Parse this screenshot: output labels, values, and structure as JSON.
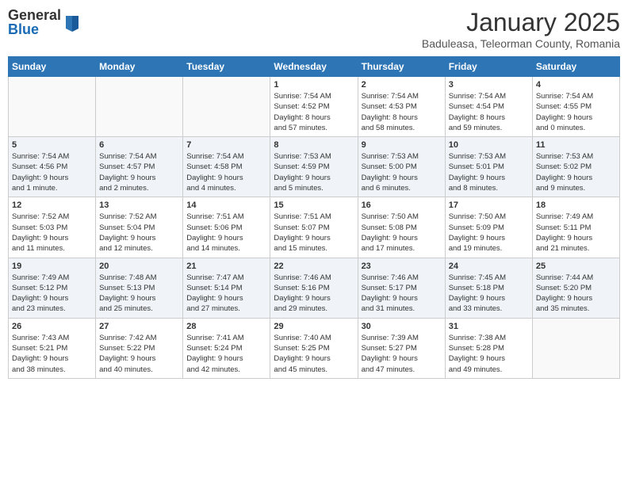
{
  "logo": {
    "general": "General",
    "blue": "Blue"
  },
  "title": "January 2025",
  "location": "Baduleasa, Teleorman County, Romania",
  "weekdays": [
    "Sunday",
    "Monday",
    "Tuesday",
    "Wednesday",
    "Thursday",
    "Friday",
    "Saturday"
  ],
  "weeks": [
    [
      {
        "day": "",
        "info": ""
      },
      {
        "day": "",
        "info": ""
      },
      {
        "day": "",
        "info": ""
      },
      {
        "day": "1",
        "info": "Sunrise: 7:54 AM\nSunset: 4:52 PM\nDaylight: 8 hours\nand 57 minutes."
      },
      {
        "day": "2",
        "info": "Sunrise: 7:54 AM\nSunset: 4:53 PM\nDaylight: 8 hours\nand 58 minutes."
      },
      {
        "day": "3",
        "info": "Sunrise: 7:54 AM\nSunset: 4:54 PM\nDaylight: 8 hours\nand 59 minutes."
      },
      {
        "day": "4",
        "info": "Sunrise: 7:54 AM\nSunset: 4:55 PM\nDaylight: 9 hours\nand 0 minutes."
      }
    ],
    [
      {
        "day": "5",
        "info": "Sunrise: 7:54 AM\nSunset: 4:56 PM\nDaylight: 9 hours\nand 1 minute."
      },
      {
        "day": "6",
        "info": "Sunrise: 7:54 AM\nSunset: 4:57 PM\nDaylight: 9 hours\nand 2 minutes."
      },
      {
        "day": "7",
        "info": "Sunrise: 7:54 AM\nSunset: 4:58 PM\nDaylight: 9 hours\nand 4 minutes."
      },
      {
        "day": "8",
        "info": "Sunrise: 7:53 AM\nSunset: 4:59 PM\nDaylight: 9 hours\nand 5 minutes."
      },
      {
        "day": "9",
        "info": "Sunrise: 7:53 AM\nSunset: 5:00 PM\nDaylight: 9 hours\nand 6 minutes."
      },
      {
        "day": "10",
        "info": "Sunrise: 7:53 AM\nSunset: 5:01 PM\nDaylight: 9 hours\nand 8 minutes."
      },
      {
        "day": "11",
        "info": "Sunrise: 7:53 AM\nSunset: 5:02 PM\nDaylight: 9 hours\nand 9 minutes."
      }
    ],
    [
      {
        "day": "12",
        "info": "Sunrise: 7:52 AM\nSunset: 5:03 PM\nDaylight: 9 hours\nand 11 minutes."
      },
      {
        "day": "13",
        "info": "Sunrise: 7:52 AM\nSunset: 5:04 PM\nDaylight: 9 hours\nand 12 minutes."
      },
      {
        "day": "14",
        "info": "Sunrise: 7:51 AM\nSunset: 5:06 PM\nDaylight: 9 hours\nand 14 minutes."
      },
      {
        "day": "15",
        "info": "Sunrise: 7:51 AM\nSunset: 5:07 PM\nDaylight: 9 hours\nand 15 minutes."
      },
      {
        "day": "16",
        "info": "Sunrise: 7:50 AM\nSunset: 5:08 PM\nDaylight: 9 hours\nand 17 minutes."
      },
      {
        "day": "17",
        "info": "Sunrise: 7:50 AM\nSunset: 5:09 PM\nDaylight: 9 hours\nand 19 minutes."
      },
      {
        "day": "18",
        "info": "Sunrise: 7:49 AM\nSunset: 5:11 PM\nDaylight: 9 hours\nand 21 minutes."
      }
    ],
    [
      {
        "day": "19",
        "info": "Sunrise: 7:49 AM\nSunset: 5:12 PM\nDaylight: 9 hours\nand 23 minutes."
      },
      {
        "day": "20",
        "info": "Sunrise: 7:48 AM\nSunset: 5:13 PM\nDaylight: 9 hours\nand 25 minutes."
      },
      {
        "day": "21",
        "info": "Sunrise: 7:47 AM\nSunset: 5:14 PM\nDaylight: 9 hours\nand 27 minutes."
      },
      {
        "day": "22",
        "info": "Sunrise: 7:46 AM\nSunset: 5:16 PM\nDaylight: 9 hours\nand 29 minutes."
      },
      {
        "day": "23",
        "info": "Sunrise: 7:46 AM\nSunset: 5:17 PM\nDaylight: 9 hours\nand 31 minutes."
      },
      {
        "day": "24",
        "info": "Sunrise: 7:45 AM\nSunset: 5:18 PM\nDaylight: 9 hours\nand 33 minutes."
      },
      {
        "day": "25",
        "info": "Sunrise: 7:44 AM\nSunset: 5:20 PM\nDaylight: 9 hours\nand 35 minutes."
      }
    ],
    [
      {
        "day": "26",
        "info": "Sunrise: 7:43 AM\nSunset: 5:21 PM\nDaylight: 9 hours\nand 38 minutes."
      },
      {
        "day": "27",
        "info": "Sunrise: 7:42 AM\nSunset: 5:22 PM\nDaylight: 9 hours\nand 40 minutes."
      },
      {
        "day": "28",
        "info": "Sunrise: 7:41 AM\nSunset: 5:24 PM\nDaylight: 9 hours\nand 42 minutes."
      },
      {
        "day": "29",
        "info": "Sunrise: 7:40 AM\nSunset: 5:25 PM\nDaylight: 9 hours\nand 45 minutes."
      },
      {
        "day": "30",
        "info": "Sunrise: 7:39 AM\nSunset: 5:27 PM\nDaylight: 9 hours\nand 47 minutes."
      },
      {
        "day": "31",
        "info": "Sunrise: 7:38 AM\nSunset: 5:28 PM\nDaylight: 9 hours\nand 49 minutes."
      },
      {
        "day": "",
        "info": ""
      }
    ]
  ]
}
